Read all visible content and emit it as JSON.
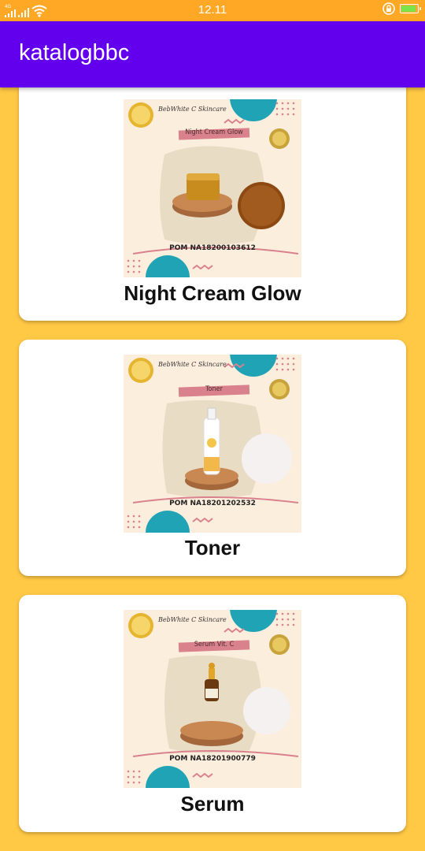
{
  "status_bar": {
    "network_label": "4G",
    "time": "12.11",
    "battery_level": 0.8,
    "battery_color": "#7CE34A",
    "icons": [
      "signal-icon",
      "signal-icon",
      "wifi-icon",
      "lock-icon",
      "battery-icon"
    ]
  },
  "app_bar": {
    "title": "katalogbbc",
    "color": "#6200EE"
  },
  "colors": {
    "background": "#FFC845",
    "status_bar": "#FFA825",
    "card": "#FFFFFF"
  },
  "products": [
    {
      "title": "Night Cream Glow",
      "image_brand": "BebWhite C Skincare",
      "image_label": "Night Cream Glow",
      "image_pom": "POM NA18200103612",
      "product_type": "jar"
    },
    {
      "title": "Toner",
      "image_brand": "BebWhite C Skincare",
      "image_label": "Toner",
      "image_pom": "POM NA18201202532",
      "product_type": "spray-bottle"
    },
    {
      "title": "Serum",
      "image_brand": "BebWhite C Skincare",
      "image_label": "Serum Vit. C",
      "image_pom": "POM NA18201900779",
      "product_type": "dropper-bottle"
    }
  ]
}
